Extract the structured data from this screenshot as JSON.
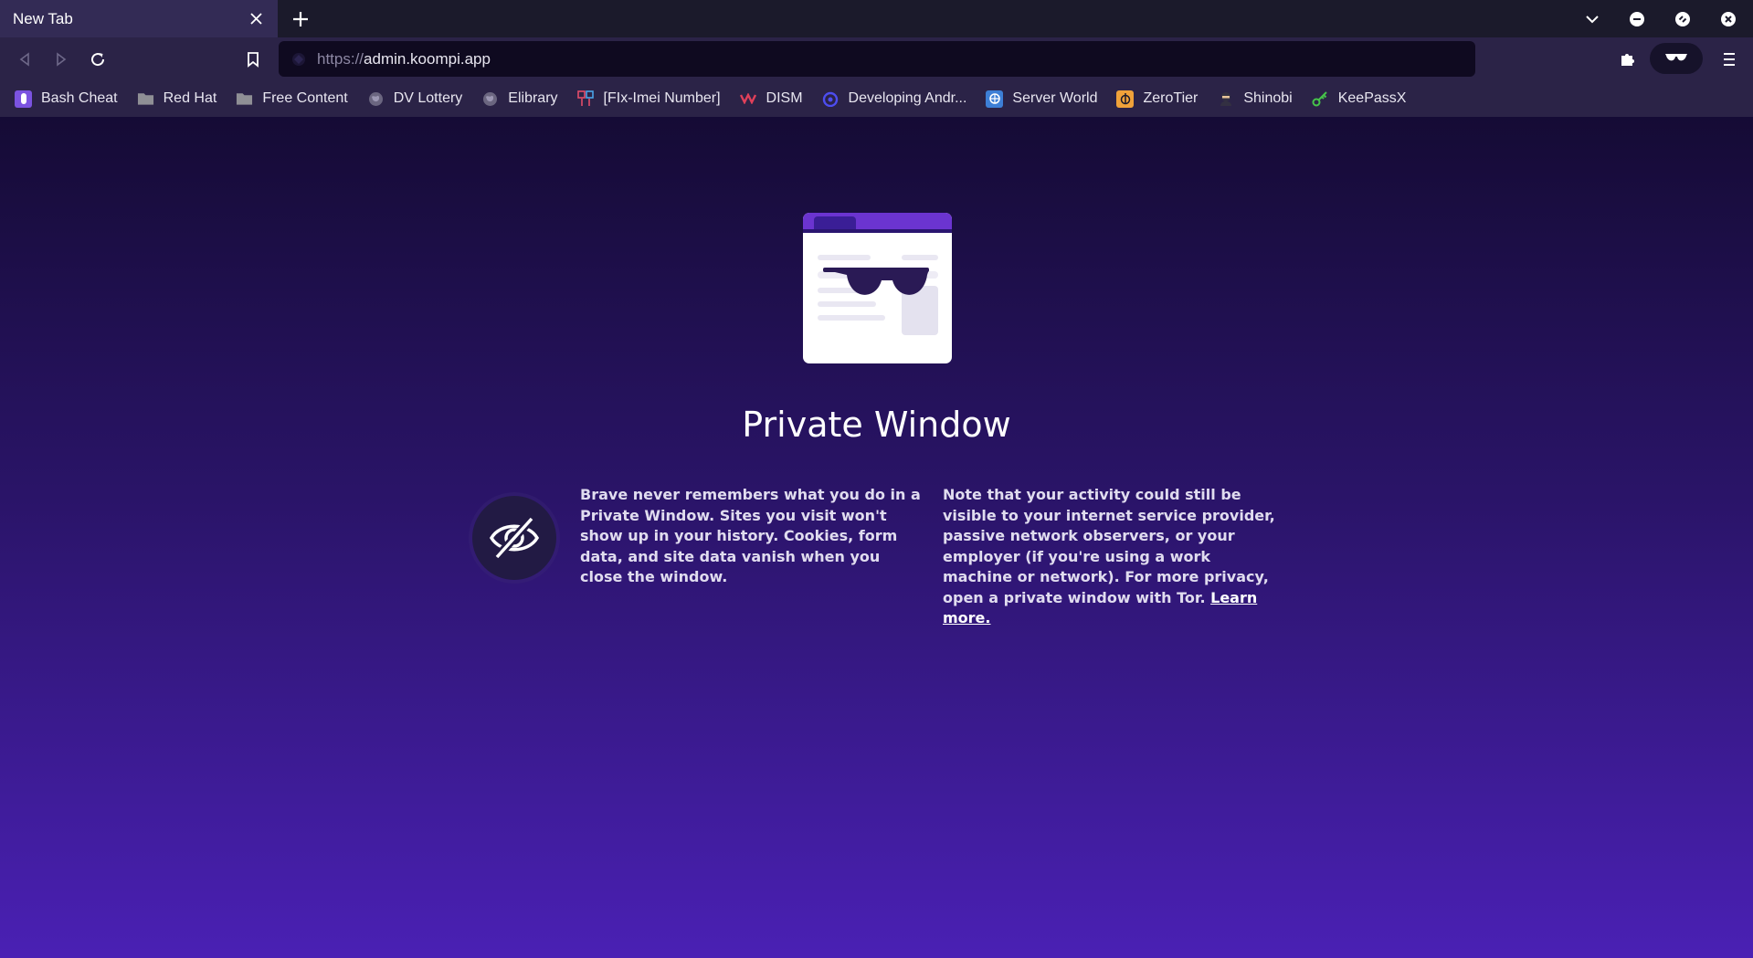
{
  "window": {
    "tab_title": "New Tab",
    "new_tab_icon": "plus-icon",
    "controls": [
      "chevron-down-icon",
      "minimize-icon",
      "restore-icon",
      "close-icon"
    ]
  },
  "toolbar": {
    "url_scheme": "https://",
    "url_host": "admin.koompi.app"
  },
  "bookmarks": [
    {
      "label": "Bash Cheat",
      "icon": "bash-cheat-favicon"
    },
    {
      "label": "Red Hat",
      "icon": "folder-icon"
    },
    {
      "label": "Free Content",
      "icon": "folder-icon"
    },
    {
      "label": "DV Lottery",
      "icon": "globe-icon"
    },
    {
      "label": "Elibrary",
      "icon": "globe-icon"
    },
    {
      "label": "[FIx-Imei Number]",
      "icon": "imei-favicon"
    },
    {
      "label": "DISM",
      "icon": "dism-favicon"
    },
    {
      "label": "Developing Andr...",
      "icon": "android-dev-favicon"
    },
    {
      "label": "Server World",
      "icon": "server-world-favicon"
    },
    {
      "label": "ZeroTier",
      "icon": "zerotier-favicon"
    },
    {
      "label": "Shinobi",
      "icon": "shinobi-favicon"
    },
    {
      "label": "KeePassX",
      "icon": "keepassx-favicon"
    }
  ],
  "main": {
    "title": "Private Window",
    "left_text": "Brave never remembers what you do in a Private Window. Sites you visit won't show up in your history. Cookies, form data, and site data vanish when you close the window.",
    "right_text": "Note that your activity could still be visible to your internet service provider, passive network observers, or your employer (if you're using a work machine or network). For more privacy, open a private window with Tor.",
    "learn_more": "Learn more."
  },
  "colors": {
    "accent": "#6a3fd8",
    "bg_top": "#150b35",
    "bg_bottom": "#4a20b4"
  }
}
